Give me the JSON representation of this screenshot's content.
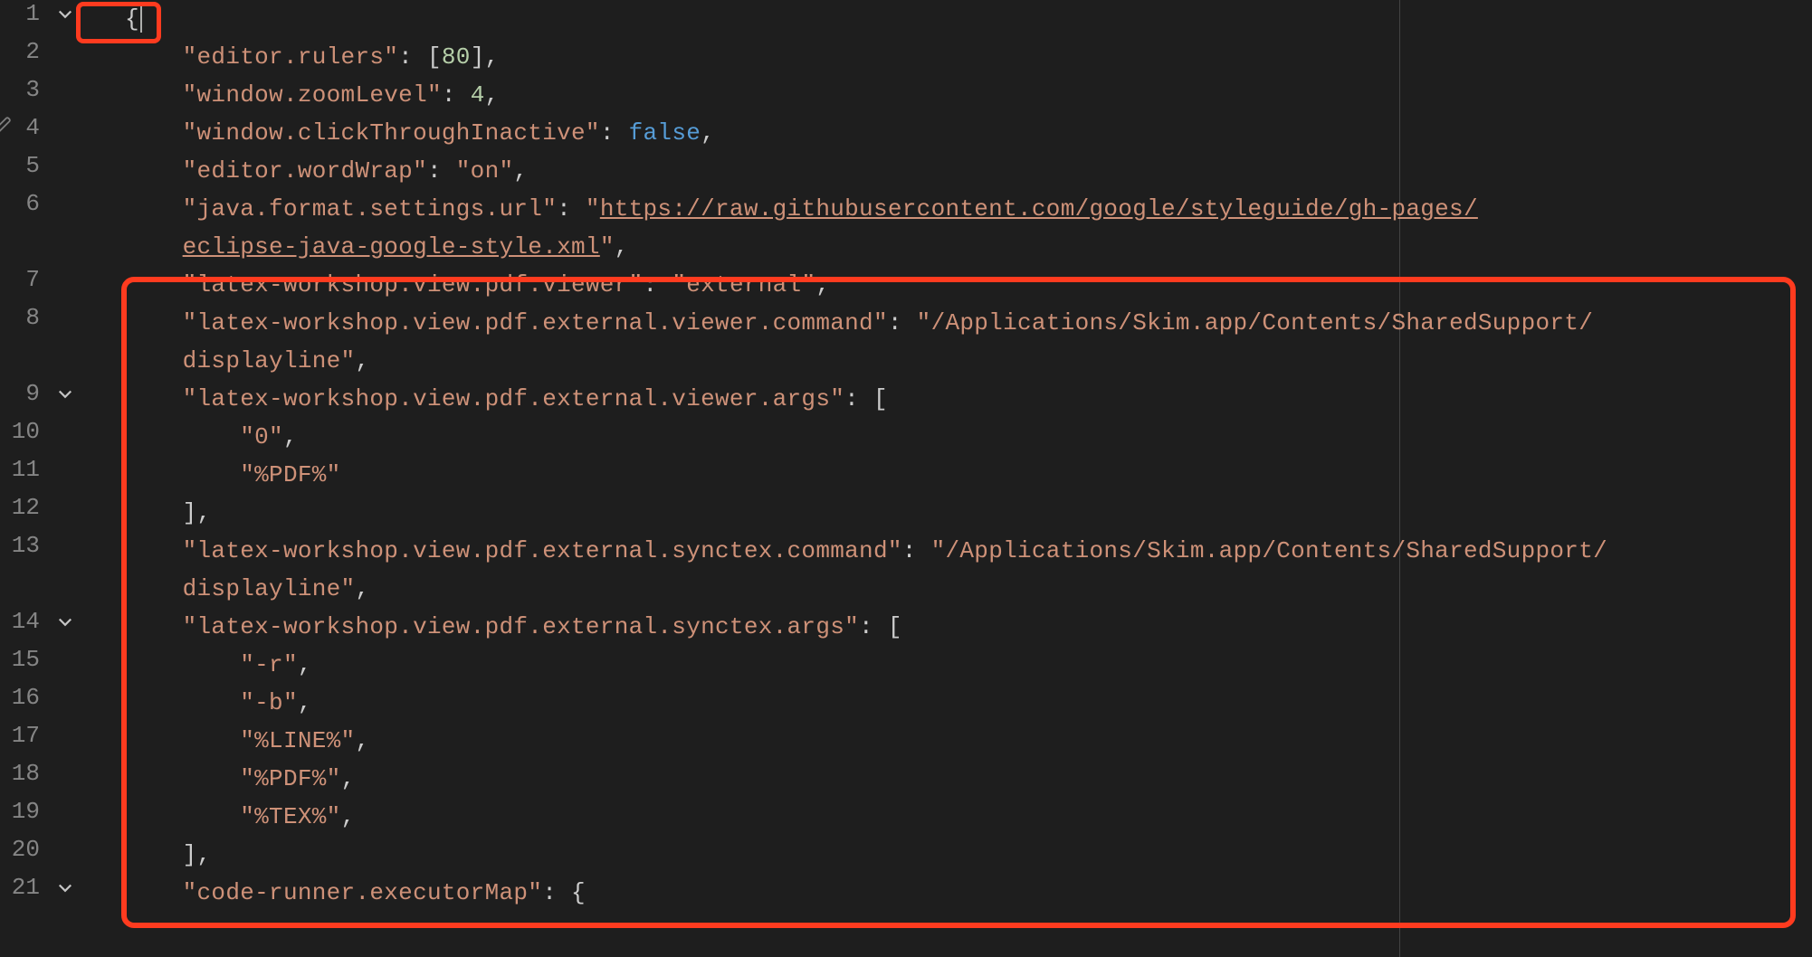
{
  "colors": {
    "string": "#ce9178",
    "number": "#b5cea8",
    "keyword": "#569cd6",
    "punct": "#cccccc",
    "gutter": "#858585",
    "bg": "#1e1e1e",
    "ruler": "#444444",
    "highlight": "#ff3b1f"
  },
  "editor": {
    "ruler_column": 80
  },
  "code_lines": [
    {
      "n": "1",
      "fold": true,
      "tokens": [
        {
          "t": "{",
          "c": "brace"
        }
      ],
      "cursor": true
    },
    {
      "n": "2",
      "fold": false,
      "tokens": [
        {
          "t": "    ",
          "c": "punct"
        },
        {
          "t": "\"editor.rulers\"",
          "c": "string"
        },
        {
          "t": ": [",
          "c": "punct"
        },
        {
          "t": "80",
          "c": "number"
        },
        {
          "t": "],",
          "c": "punct"
        }
      ]
    },
    {
      "n": "3",
      "fold": false,
      "tokens": [
        {
          "t": "    ",
          "c": "punct"
        },
        {
          "t": "\"window.zoomLevel\"",
          "c": "string"
        },
        {
          "t": ": ",
          "c": "punct"
        },
        {
          "t": "4",
          "c": "number"
        },
        {
          "t": ",",
          "c": "punct"
        }
      ]
    },
    {
      "n": "4",
      "fold": false,
      "tokens": [
        {
          "t": "    ",
          "c": "punct"
        },
        {
          "t": "\"window.clickThroughInactive\"",
          "c": "string"
        },
        {
          "t": ": ",
          "c": "punct"
        },
        {
          "t": "false",
          "c": "keyword"
        },
        {
          "t": ",",
          "c": "punct"
        }
      ]
    },
    {
      "n": "5",
      "fold": false,
      "tokens": [
        {
          "t": "    ",
          "c": "punct"
        },
        {
          "t": "\"editor.wordWrap\"",
          "c": "string"
        },
        {
          "t": ": ",
          "c": "punct"
        },
        {
          "t": "\"on\"",
          "c": "string"
        },
        {
          "t": ",",
          "c": "punct"
        }
      ]
    },
    {
      "n": "6",
      "fold": false,
      "tokens": [
        {
          "t": "    ",
          "c": "punct"
        },
        {
          "t": "\"java.format.settings.url\"",
          "c": "string"
        },
        {
          "t": ": ",
          "c": "punct"
        },
        {
          "t": "\"",
          "c": "string"
        },
        {
          "t": "https://raw.githubusercontent.com/google/styleguide/gh-pages/",
          "c": "link"
        }
      ]
    },
    {
      "n": "",
      "fold": false,
      "wrap": true,
      "tokens": [
        {
          "t": "    ",
          "c": "punct"
        },
        {
          "t": "eclipse-java-google-style.xml",
          "c": "link"
        },
        {
          "t": "\"",
          "c": "string"
        },
        {
          "t": ",",
          "c": "punct"
        }
      ]
    },
    {
      "n": "7",
      "fold": false,
      "tokens": [
        {
          "t": "    ",
          "c": "punct"
        },
        {
          "t": "\"latex-workshop.view.pdf.viewer\"",
          "c": "string"
        },
        {
          "t": ": ",
          "c": "punct"
        },
        {
          "t": "\"external\"",
          "c": "string"
        },
        {
          "t": ",",
          "c": "punct"
        }
      ]
    },
    {
      "n": "8",
      "fold": false,
      "tokens": [
        {
          "t": "    ",
          "c": "punct"
        },
        {
          "t": "\"latex-workshop.view.pdf.external.viewer.command\"",
          "c": "string"
        },
        {
          "t": ": ",
          "c": "punct"
        },
        {
          "t": "\"/Applications/Skim.app/Contents/SharedSupport/",
          "c": "string"
        }
      ]
    },
    {
      "n": "",
      "fold": false,
      "wrap": true,
      "tokens": [
        {
          "t": "    ",
          "c": "punct"
        },
        {
          "t": "displayline\"",
          "c": "string"
        },
        {
          "t": ",",
          "c": "punct"
        }
      ]
    },
    {
      "n": "9",
      "fold": true,
      "tokens": [
        {
          "t": "    ",
          "c": "punct"
        },
        {
          "t": "\"latex-workshop.view.pdf.external.viewer.args\"",
          "c": "string"
        },
        {
          "t": ": [",
          "c": "punct"
        }
      ]
    },
    {
      "n": "10",
      "fold": false,
      "tokens": [
        {
          "t": "        ",
          "c": "punct"
        },
        {
          "t": "\"0\"",
          "c": "string"
        },
        {
          "t": ",",
          "c": "punct"
        }
      ]
    },
    {
      "n": "11",
      "fold": false,
      "tokens": [
        {
          "t": "        ",
          "c": "punct"
        },
        {
          "t": "\"%PDF%\"",
          "c": "string"
        }
      ]
    },
    {
      "n": "12",
      "fold": false,
      "tokens": [
        {
          "t": "    ",
          "c": "punct"
        },
        {
          "t": "],",
          "c": "punct"
        }
      ]
    },
    {
      "n": "13",
      "fold": false,
      "tokens": [
        {
          "t": "    ",
          "c": "punct"
        },
        {
          "t": "\"latex-workshop.view.pdf.external.synctex.command\"",
          "c": "string"
        },
        {
          "t": ": ",
          "c": "punct"
        },
        {
          "t": "\"/Applications/Skim.app/Contents/SharedSupport/",
          "c": "string"
        }
      ]
    },
    {
      "n": "",
      "fold": false,
      "wrap": true,
      "tokens": [
        {
          "t": "    ",
          "c": "punct"
        },
        {
          "t": "displayline\"",
          "c": "string"
        },
        {
          "t": ",",
          "c": "punct"
        }
      ]
    },
    {
      "n": "14",
      "fold": true,
      "tokens": [
        {
          "t": "    ",
          "c": "punct"
        },
        {
          "t": "\"latex-workshop.view.pdf.external.synctex.args\"",
          "c": "string"
        },
        {
          "t": ": [",
          "c": "punct"
        }
      ]
    },
    {
      "n": "15",
      "fold": false,
      "tokens": [
        {
          "t": "        ",
          "c": "punct"
        },
        {
          "t": "\"-r\"",
          "c": "string"
        },
        {
          "t": ",",
          "c": "punct"
        }
      ]
    },
    {
      "n": "16",
      "fold": false,
      "tokens": [
        {
          "t": "        ",
          "c": "punct"
        },
        {
          "t": "\"-b\"",
          "c": "string"
        },
        {
          "t": ",",
          "c": "punct"
        }
      ]
    },
    {
      "n": "17",
      "fold": false,
      "tokens": [
        {
          "t": "        ",
          "c": "punct"
        },
        {
          "t": "\"%LINE%\"",
          "c": "string"
        },
        {
          "t": ",",
          "c": "punct"
        }
      ]
    },
    {
      "n": "18",
      "fold": false,
      "tokens": [
        {
          "t": "        ",
          "c": "punct"
        },
        {
          "t": "\"%PDF%\"",
          "c": "string"
        },
        {
          "t": ",",
          "c": "punct"
        }
      ]
    },
    {
      "n": "19",
      "fold": false,
      "tokens": [
        {
          "t": "        ",
          "c": "punct"
        },
        {
          "t": "\"%TEX%\"",
          "c": "string"
        },
        {
          "t": ",",
          "c": "punct"
        }
      ]
    },
    {
      "n": "20",
      "fold": false,
      "tokens": [
        {
          "t": "    ",
          "c": "punct"
        },
        {
          "t": "],",
          "c": "punct"
        }
      ]
    },
    {
      "n": "21",
      "fold": true,
      "tokens": [
        {
          "t": "    ",
          "c": "punct"
        },
        {
          "t": "\"code-runner.executorMap\"",
          "c": "string"
        },
        {
          "t": ": {",
          "c": "punct"
        }
      ]
    }
  ]
}
